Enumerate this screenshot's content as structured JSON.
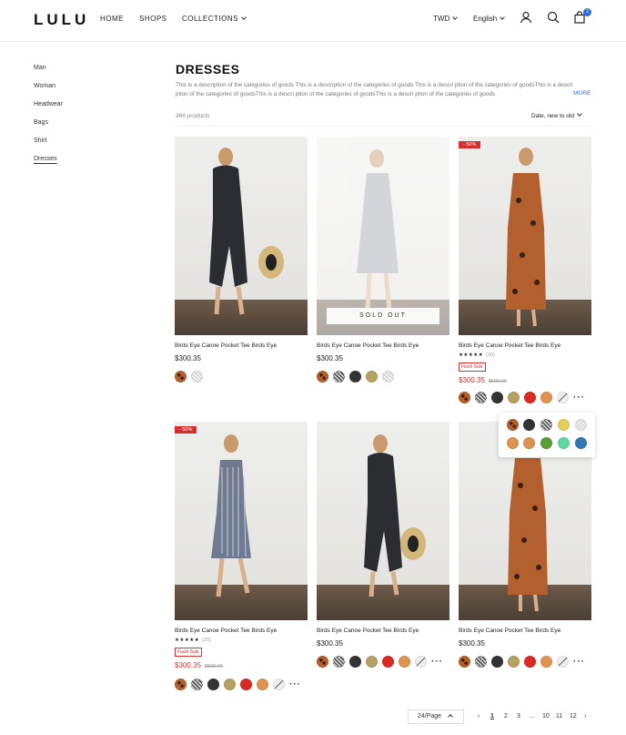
{
  "header": {
    "logo": "LULU",
    "nav": [
      "HOME",
      "SHOPS",
      "COLLECTIONS"
    ],
    "currency": "TWD",
    "language": "English",
    "cart_count": "2"
  },
  "sidebar": {
    "items": [
      "Man",
      "Woman",
      "Headwear",
      "Bags",
      "Shirt",
      "Dresses"
    ],
    "active": "Dresses"
  },
  "category": {
    "title": "DRESSES",
    "description": "This is a description of the categories of goods This is a description of the categories of goods This is a descri ption of the categories of goodsThis is a descri ption of the categories of goodsThis is a descri ption of the categories of goodsThis is a descri ption of the categories of goods",
    "more_label": "MORE",
    "count": "966 products",
    "sort_label": "Date, new to old"
  },
  "products": [
    {
      "name": "Birds Eye Canoe Pocket Tee Birds Eye",
      "price": "$300.35"
    },
    {
      "name": "Birds Eye Canoe Pocket Tee Birds Eye",
      "price": "$300.35",
      "sold_out_label": "SOLD OUT"
    },
    {
      "name": "Birds Eye Canoe Pocket Tee Birds Eye",
      "price": "$300.35",
      "old_price": "$500.00",
      "discount": "- 50%",
      "rating_reviews": "(20)",
      "flash_label": "Flash Sale"
    },
    {
      "name": "Birds Eye Canoe Pocket Tee Birds Eye",
      "price": "$300.35",
      "old_price": "$500.00",
      "discount": "- 50%",
      "rating_reviews": "(20)",
      "flash_label": "Flash Sale"
    },
    {
      "name": "Birds Eye Canoe Pocket Tee Birds Eye",
      "price": "$300.35"
    },
    {
      "name": "Birds Eye Canoe Pocket Tee Birds Eye",
      "price": "$300.35"
    }
  ],
  "rating_stars": "★★★★★",
  "pagination": {
    "per_page": "24/Page",
    "pages": [
      "1",
      "2",
      "3",
      "...",
      "10",
      "11",
      "12"
    ],
    "current": "1"
  },
  "colors": {
    "accent": "#2a6fd6",
    "sale": "#d32f2f",
    "swatch_palette": [
      "#b4602e",
      "#333333",
      "#7a7f88",
      "#b5a162",
      "#d92b24",
      "#dd9450",
      "#e2d058",
      "#5a9e37",
      "#5fd7a0",
      "#3577b4"
    ]
  }
}
